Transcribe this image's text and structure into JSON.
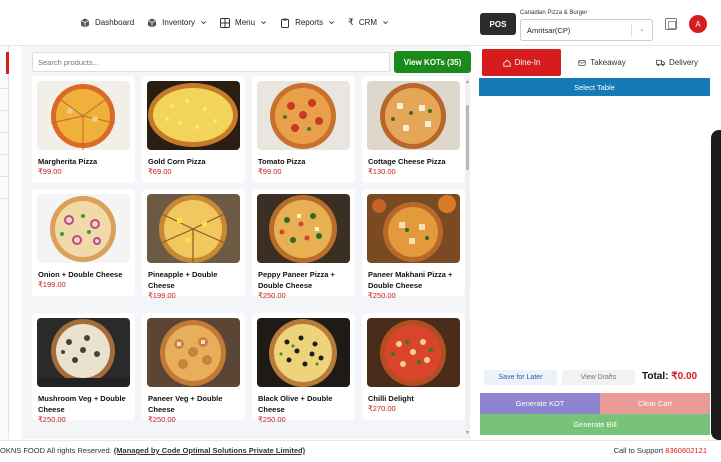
{
  "nav": {
    "items": [
      {
        "label": "Dashboard",
        "icon": "cube-icon",
        "has_dropdown": false
      },
      {
        "label": "Inventory",
        "icon": "cube-icon",
        "has_dropdown": true
      },
      {
        "label": "Menu",
        "icon": "grid-menu-icon",
        "has_dropdown": true
      },
      {
        "label": "Reports",
        "icon": "clipboard-icon",
        "has_dropdown": true
      },
      {
        "label": "CRM",
        "icon": "rupee-icon",
        "has_dropdown": true
      }
    ],
    "pos_label": "POS",
    "branch_caption": "Canadian Pizza & Burger",
    "branch_value": "Amritsar(CP)",
    "avatar_letter": "A"
  },
  "products": {
    "search_placeholder": "Search products...",
    "kot_button": "View KOTs (35)",
    "items": [
      {
        "name": "Margherita Pizza",
        "price": "₹99.00"
      },
      {
        "name": "Gold Corn Pizza",
        "price": "₹69.00"
      },
      {
        "name": "Tomato Pizza",
        "price": "₹99.00"
      },
      {
        "name": "Cottage Cheese Pizza",
        "price": "₹130.00"
      },
      {
        "name": "Onion + Double Cheese",
        "price": "₹199.00"
      },
      {
        "name": "Pineapple + Double Cheese",
        "price": "₹199.00"
      },
      {
        "name": "Peppy Paneer Pizza + Double Cheese",
        "price": "₹250.00"
      },
      {
        "name": "Paneer Makhani Pizza + Double Cheese",
        "price": "₹250.00"
      },
      {
        "name": "Mushroom Veg + Double Cheese",
        "price": "₹250.00"
      },
      {
        "name": "Paneer Veg + Double Cheese",
        "price": "₹250.00"
      },
      {
        "name": "Black Olive + Double Cheese",
        "price": "₹250.00"
      },
      {
        "name": "Chilli Delight",
        "price": "₹270.00"
      }
    ]
  },
  "order": {
    "tabs": [
      {
        "label": "Dine-In",
        "icon": "home-icon",
        "active": true
      },
      {
        "label": "Takeaway",
        "icon": "bag-icon",
        "active": false
      },
      {
        "label": "Delivery",
        "icon": "truck-icon",
        "active": false
      }
    ],
    "select_table": "Select Table",
    "save_later": "Save for Later",
    "view_drafts": "View Drafts",
    "total_label": "Total:",
    "total_value": "₹0.00",
    "generate_kot": "Generate KOT",
    "clear_cart": "Clear Cart",
    "generate_bill": "Generate Bill"
  },
  "footer": {
    "rights": "OKNS FOOD All rights Reserved.",
    "managed_by": "(Managed by Code Optimal Solutions Private Limited)",
    "support_label": "Call to Support",
    "support_phone": "8360602121"
  },
  "colors": {
    "brand_red": "#d61c1c",
    "kot_green": "#1b8a1b",
    "table_blue": "#157ab6",
    "kot_purple": "#8e83cf",
    "clear_pink": "#e99b96",
    "bill_green": "#79c27a"
  }
}
